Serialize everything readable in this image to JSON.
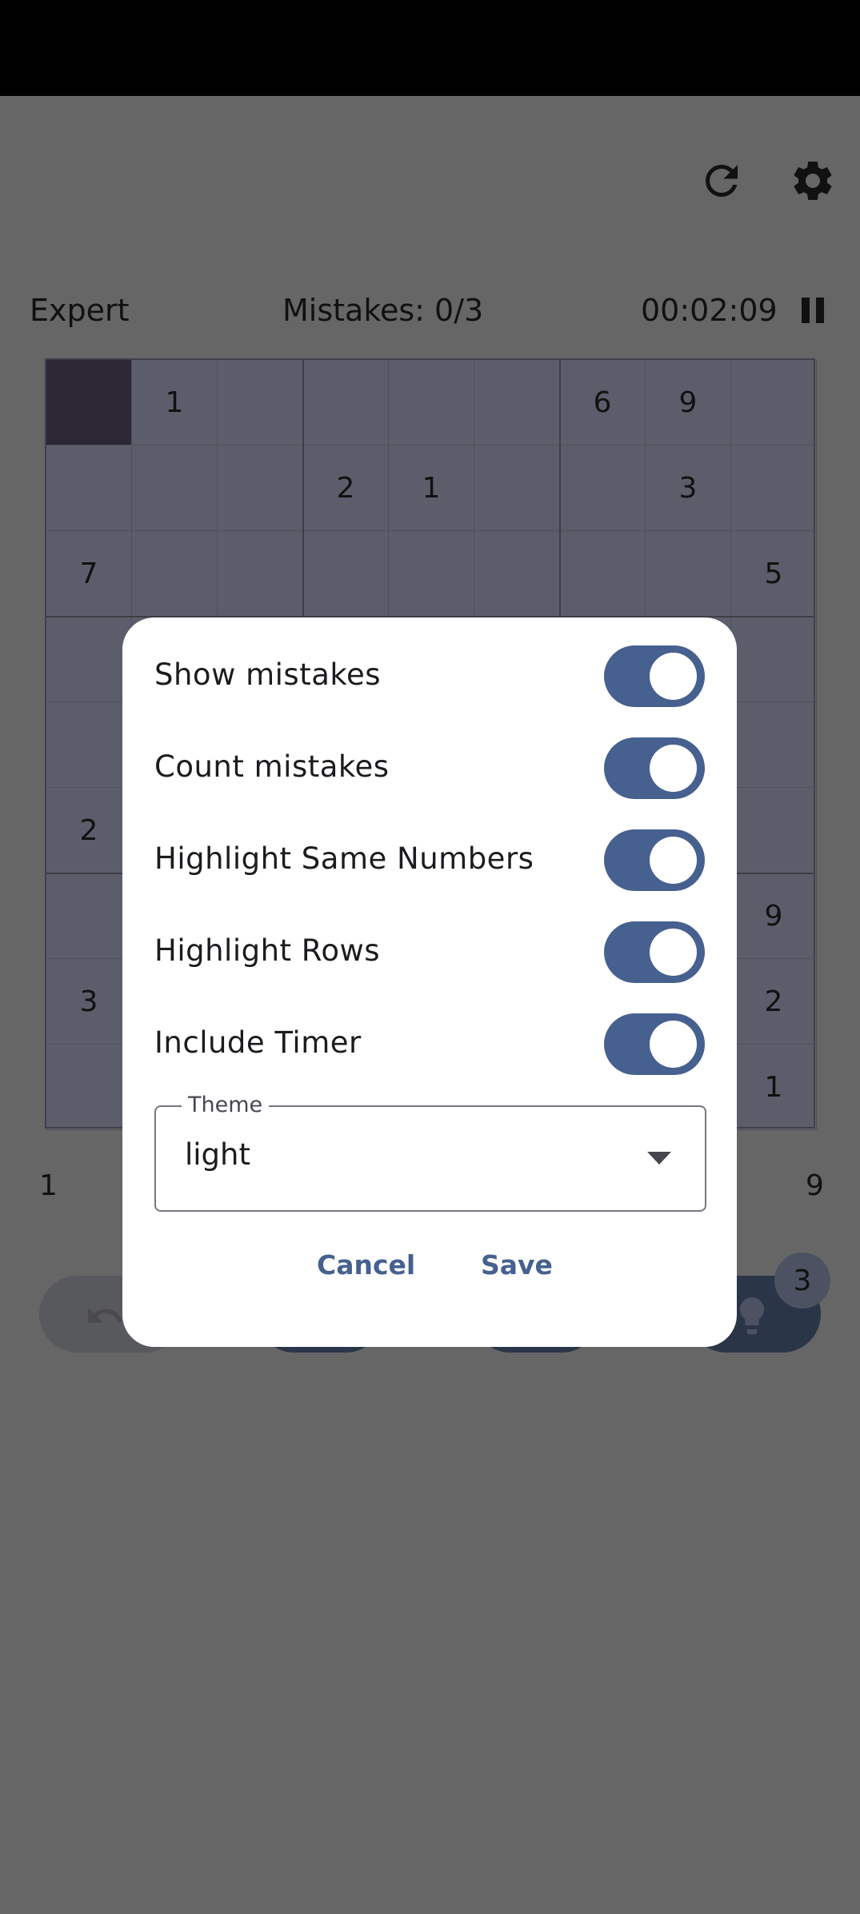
{
  "header": {
    "difficulty": "Expert",
    "mistakes_text": "Mistakes: 0/3",
    "timer": "00:02:09",
    "icons": [
      "refresh-icon",
      "settings-icon",
      "pause-icon"
    ]
  },
  "board": {
    "selected_cell": [
      0,
      0
    ],
    "grid": [
      [
        "",
        "1",
        "",
        "",
        "",
        "",
        "6",
        "9",
        ""
      ],
      [
        "",
        "",
        "",
        "2",
        "1",
        "",
        "",
        "3",
        ""
      ],
      [
        "7",
        "",
        "",
        "",
        "",
        "",
        "",
        "",
        "5"
      ],
      [
        "",
        "",
        "",
        "",
        "",
        "",
        "",
        "",
        ""
      ],
      [
        "",
        "",
        "",
        "",
        "",
        "",
        "",
        "",
        ""
      ],
      [
        "2",
        "",
        "",
        "",
        "",
        "",
        "",
        "",
        ""
      ],
      [
        "",
        "",
        "",
        "",
        "",
        "",
        "",
        "",
        "9"
      ],
      [
        "3",
        "",
        "",
        "",
        "",
        "",
        "",
        "",
        "2"
      ],
      [
        "",
        "",
        "",
        "",
        "",
        "",
        "",
        "",
        "1"
      ]
    ]
  },
  "numpad": {
    "first": "1",
    "last": "9"
  },
  "hint": {
    "count": "3"
  },
  "dialog": {
    "toggles": [
      {
        "label": "Show mistakes",
        "on": true
      },
      {
        "label": "Count mistakes",
        "on": true
      },
      {
        "label": "Highlight Same Numbers",
        "on": true
      },
      {
        "label": "Highlight Rows",
        "on": true
      },
      {
        "label": "Include Timer",
        "on": true
      }
    ],
    "theme": {
      "label": "Theme",
      "value": "light"
    },
    "cancel_label": "Cancel",
    "save_label": "Save",
    "accent_color": "#46608f"
  }
}
